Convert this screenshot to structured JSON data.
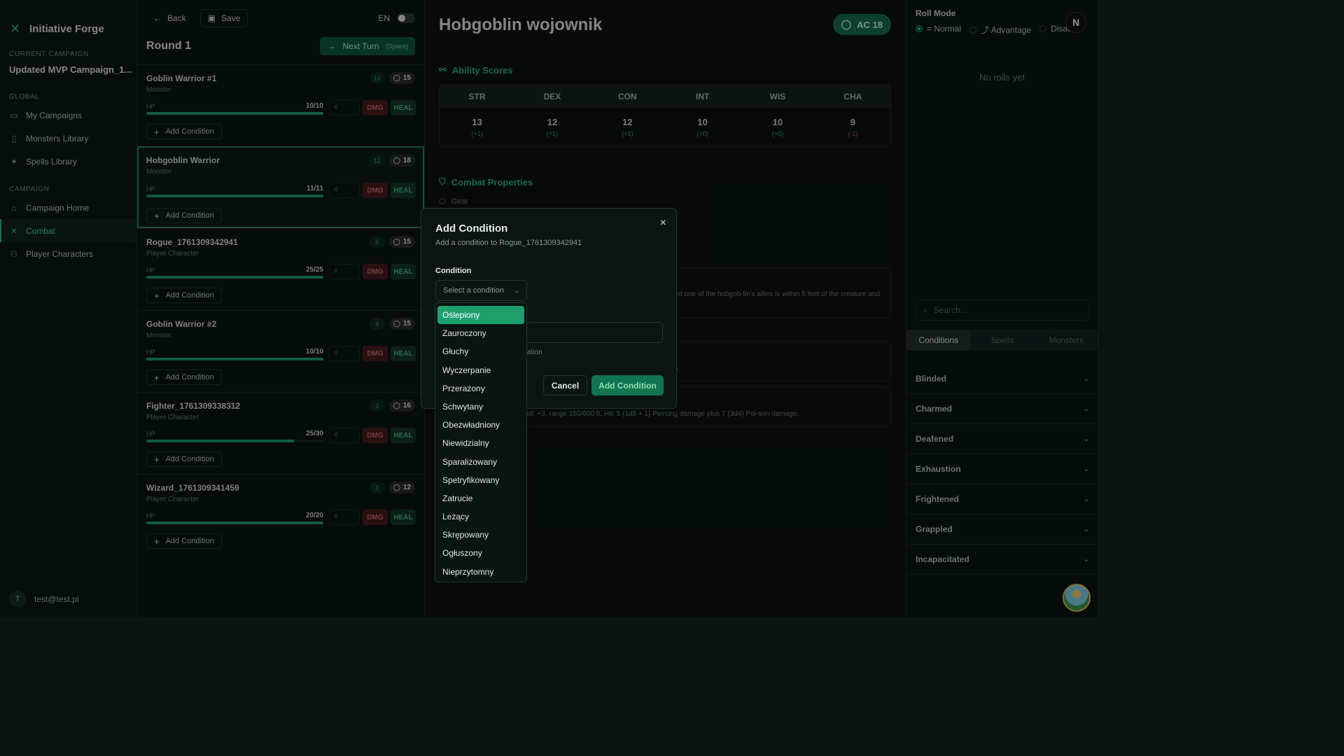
{
  "app": {
    "title": "Initiative Forge"
  },
  "sidebar": {
    "current_campaign_label": "CURRENT CAMPAIGN",
    "campaign_name": "Updated MVP Campaign_1...",
    "global_label": "GLOBAL",
    "global_items": [
      {
        "label": "My Campaigns",
        "icon": "folder-icon"
      },
      {
        "label": "Monsters Library",
        "icon": "book-icon"
      },
      {
        "label": "Spells Library",
        "icon": "sparkles-icon"
      }
    ],
    "campaign_label": "CAMPAIGN",
    "campaign_items": [
      {
        "label": "Campaign Home",
        "icon": "home-icon"
      },
      {
        "label": "Combat",
        "icon": "swords-icon",
        "active": true
      },
      {
        "label": "Player Characters",
        "icon": "users-icon"
      }
    ],
    "user": {
      "initial": "T",
      "email": "test@test.pl"
    }
  },
  "combat": {
    "back_label": "Back",
    "save_label": "Save",
    "lang_label": "EN",
    "round_title": "Round 1",
    "next_turn_label": "Next Turn",
    "next_turn_shortcut": "(Space)",
    "hp_label": "HP",
    "input_placeholder": "#",
    "dmg_label": "DMG",
    "heal_label": "HEAL",
    "add_condition_label": "Add Condition",
    "combatants": [
      {
        "name": "Goblin Warrior #1",
        "type": "Monster",
        "initiative": "16",
        "ac": "15",
        "hp": "10/10",
        "hp_fraction": 1.0
      },
      {
        "name": "Hobgoblin Warrior",
        "type": "Monster",
        "initiative": "12",
        "ac": "18",
        "hp": "11/11",
        "hp_fraction": 1.0,
        "active": true
      },
      {
        "name": "Rogue_1761309342941",
        "type": "Player Character",
        "initiative": "8",
        "ac": "15",
        "hp": "25/25",
        "hp_fraction": 1.0
      },
      {
        "name": "Goblin Warrior #2",
        "type": "Monster",
        "initiative": "4",
        "ac": "15",
        "hp": "10/10",
        "hp_fraction": 1.0
      },
      {
        "name": "Fighter_1761309338312",
        "type": "Player Character",
        "initiative": "3",
        "ac": "16",
        "hp": "25/30",
        "hp_fraction": 0.833
      },
      {
        "name": "Wizard_1761309341459",
        "type": "Player Character",
        "initiative": "3",
        "ac": "12",
        "hp": "20/20",
        "hp_fraction": 1.0
      }
    ]
  },
  "detail": {
    "title": "Hobgoblin wojownik",
    "ac_label": "AC 18",
    "ability_title": "Ability Scores",
    "abilities": [
      {
        "name": "STR",
        "score": "13",
        "mod": "(+1)"
      },
      {
        "name": "DEX",
        "score": "12",
        "mod": "(+1)"
      },
      {
        "name": "CON",
        "score": "12",
        "mod": "(+1)"
      },
      {
        "name": "INT",
        "score": "10",
        "mod": "(+0)"
      },
      {
        "name": "WIS",
        "score": "10",
        "mod": "(+0)"
      },
      {
        "name": "CHA",
        "score": "9",
        "mod": "(-1)",
        "negative": true
      }
    ],
    "combat_props_title": "Combat Properties",
    "gear_label": "Gear",
    "trait_text": "ast one of the hobgob-lin's allies is within 5 feet of the creature and",
    "trait2_text": "ge.",
    "action_text": "oll: +3, range 150/600 ft. Hit: 5 (1d8 + 1) Piercing damage plus 7 (3d4) Poi-son damage."
  },
  "right_panel": {
    "roll_mode_title": "Roll Mode",
    "roll_modes": [
      "Normal",
      "Advantage",
      "Disadv"
    ],
    "no_rolls": "No rolls yet",
    "avatar_initial": "N",
    "search_placeholder": "Search...",
    "tabs": [
      "Conditions",
      "Spells",
      "Monsters"
    ],
    "conditions": [
      "Blinded",
      "Charmed",
      "Deafened",
      "Exhaustion",
      "Frightened",
      "Grappled",
      "Incapacitated"
    ]
  },
  "modal": {
    "title": "Add Condition",
    "subtitle": "Add a condition to Rogue_1761309342941",
    "condition_label": "Condition",
    "select_placeholder": "Select a condition",
    "hint_text": "ation",
    "cancel_label": "Cancel",
    "add_label": "Add Condition",
    "options": [
      "Oślepiony",
      "Zauroczony",
      "Głuchy",
      "Wyczerpanie",
      "Przerażony",
      "Schwytany",
      "Obezwładniony",
      "Niewidzialny",
      "Sparaliżowany",
      "Spetryfikowany",
      "Zatrucie",
      "Leżący",
      "Skrępowany",
      "Ogłuszony",
      "Nieprzytomny"
    ],
    "selected_index": 0
  },
  "colors": {
    "accent": "#22c38e",
    "danger": "#4a1c1e",
    "heal": "#14382a",
    "background": "#0b1411"
  }
}
